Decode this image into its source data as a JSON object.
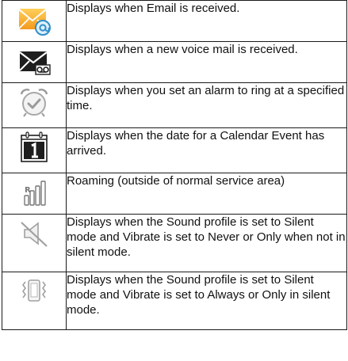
{
  "rows": [
    {
      "icon": "email-received-icon",
      "text": "Displays when Email is received."
    },
    {
      "icon": "new-voicemail-icon",
      "text": "Displays when a new voice mail is received."
    },
    {
      "icon": "alarm-clock-icon",
      "text": "Displays when you set an alarm to ring at a specified time."
    },
    {
      "icon": "calendar-event-icon",
      "text": "Displays when the date for a Calendar Event has arrived."
    },
    {
      "icon": "roaming-signal-icon",
      "text": "Roaming (outside of normal service area)"
    },
    {
      "icon": "silent-mode-icon",
      "text": "Displays when the Sound profile is set to Silent mode and Vibrate is set to Never or Only when not in silent mode."
    },
    {
      "icon": "vibrate-mode-icon",
      "text": "Displays when the Sound profile is set to Silent mode and Vibrate is set to Always or Only in silent mode."
    }
  ],
  "colors": {
    "email_orange": "#f5a623",
    "email_blue": "#2f8fc9",
    "dark_icon": "#1e1e1e",
    "gray_icon": "#9a9a9a"
  }
}
